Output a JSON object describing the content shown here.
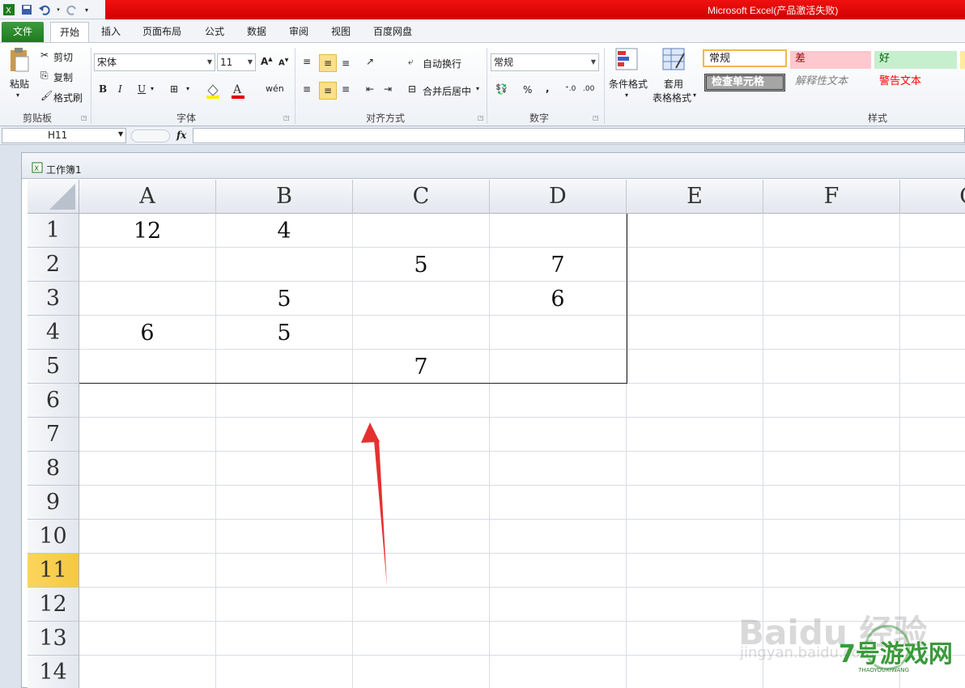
{
  "window": {
    "title": "Microsoft Excel(产品激活失败)"
  },
  "tabs": [
    "文件",
    "开始",
    "插入",
    "页面布局",
    "公式",
    "数据",
    "审阅",
    "视图",
    "百度网盘"
  ],
  "ribbon": {
    "clipboard": {
      "paste": "粘贴",
      "cut": "剪切",
      "copy": "复制",
      "format_painter": "格式刷",
      "label": "剪贴板"
    },
    "font": {
      "name": "宋体",
      "size": "11",
      "bold": "B",
      "italic": "I",
      "underline": "U",
      "label": "字体"
    },
    "alignment": {
      "wrap": "自动换行",
      "merge": "合并后居中",
      "label": "对齐方式"
    },
    "number": {
      "format": "常规",
      "percent": "%",
      "comma": ",",
      "label": "数字"
    },
    "styles": {
      "cond_format": "条件格式",
      "table_format_1": "套用",
      "table_format_2": "表格格式",
      "normal": "常规",
      "bad": "差",
      "good": "好",
      "check_cell": "检查单元格",
      "explanatory": "解释性文本",
      "warning": "警告文本",
      "label": "样式"
    }
  },
  "formula_bar": {
    "name_box": "H11",
    "fx": "fx",
    "value": ""
  },
  "workbook": {
    "title": "工作簿1"
  },
  "columns": [
    "A",
    "B",
    "C",
    "D",
    "E",
    "F",
    "G"
  ],
  "rows": [
    "1",
    "2",
    "3",
    "4",
    "5",
    "6",
    "7",
    "8",
    "9",
    "10",
    "11",
    "12",
    "13",
    "14"
  ],
  "selected_row": "11",
  "cells": {
    "A1": "12",
    "B1": "4",
    "C2": "5",
    "D2": "7",
    "B3": "5",
    "D3": "6",
    "A4": "6",
    "B4": "5",
    "C5": "7"
  },
  "watermark": {
    "baidu": "Baidu 经验",
    "jingyan": "jingyan.baidu.com",
    "site": "7号游戏网",
    "site_sub": "7HAOYOUXIWANG"
  },
  "colors": {
    "file_tab": "#2e8b2e",
    "title_band": "#e00000",
    "selected_row": "#f8cf4e",
    "arrow": "#e63030"
  }
}
